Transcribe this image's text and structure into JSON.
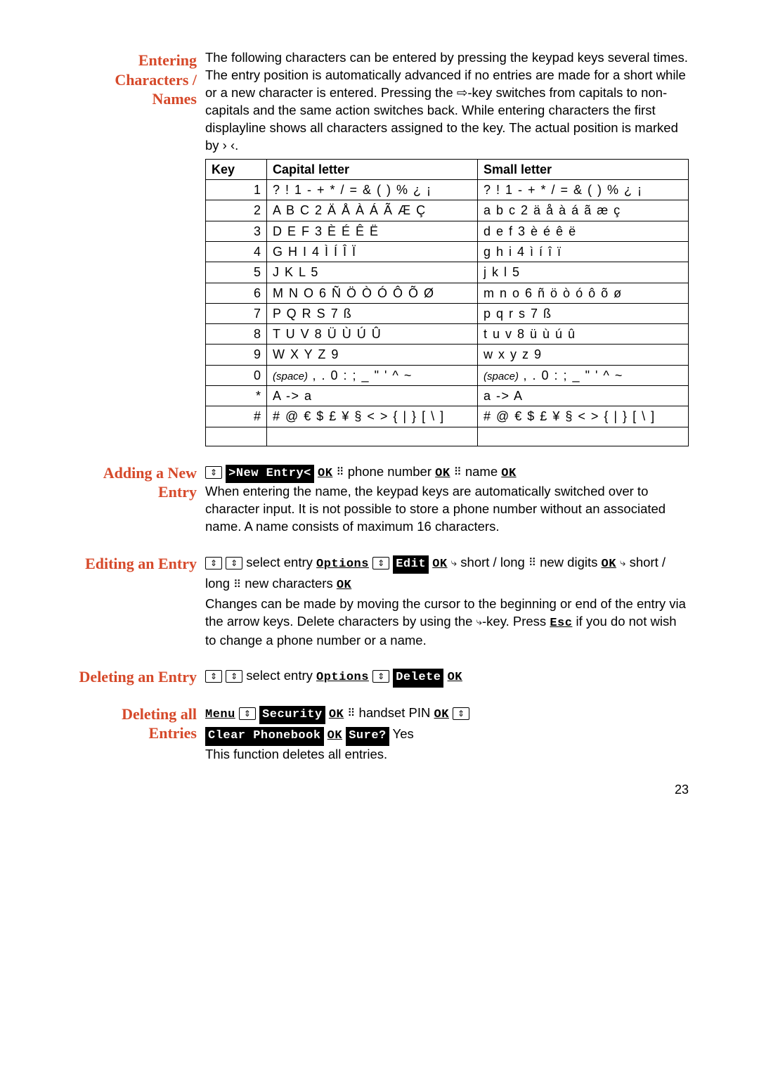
{
  "sections": {
    "entering": {
      "title": "Entering Characters / Names",
      "para": "The following characters can be entered by pressing the keypad keys several times. The entry position is automatically advanced if no entries are made for a short while or a new character is entered. Pressing the ⇨-key switches from capitals to non-capitals and the same action switches back. While entering characters the first displayline shows all characters assigned to the key. The actual position is marked by › ‹."
    },
    "adding": {
      "title": "Adding a New Entry",
      "para": "When entering the name, the keypad keys are automatically switched over to character input. It is not possible to store a phone number without an associated name. A name consists of maximum 16 characters."
    },
    "editing": {
      "title": "Editing an Entry",
      "para": "Changes can be made by moving the cursor to the beginning or end of the entry via the arrow keys. Delete characters by using the ⇨-key. Press Esc if you do not wish to change a phone number or a name."
    },
    "deleting": {
      "title": "Deleting an Entry"
    },
    "deletingAll": {
      "title": "Deleting all Entries",
      "para": "This function deletes all entries."
    }
  },
  "table": {
    "headers": [
      "Key",
      "Capital letter",
      "Small letter"
    ],
    "rows": [
      {
        "key": "1",
        "cap": "? ! 1 - + * / = & ( ) % ¿ ¡",
        "small": "? ! 1 - + * / = & ( ) % ¿ ¡"
      },
      {
        "key": "2",
        "cap": "A B C 2 Ä Å À Á Ã Æ Ç",
        "small": "a b c 2 ä å à á ã æ ç"
      },
      {
        "key": "3",
        "cap": "D E F 3 È É Ê Ë",
        "small": "d e f 3 è é ê ë"
      },
      {
        "key": "4",
        "cap": "G H I 4 Ì Í Î Ï",
        "small": "g h i 4 ì í î ï"
      },
      {
        "key": "5",
        "cap": "J K L 5",
        "small": "j k l 5"
      },
      {
        "key": "6",
        "cap": "M N O 6 Ñ Ö Ò Ó Ô Õ Ø",
        "small": "m n o 6 ñ ö ò ó ô õ ø"
      },
      {
        "key": "7",
        "cap": "P Q R S 7 ß",
        "small": "p q r s 7 ß"
      },
      {
        "key": "8",
        "cap": "T U V 8 Ü Ù Ú Û",
        "small": "t u v 8 ü ù ú û"
      },
      {
        "key": "9",
        "cap": "W X Y Z 9",
        "small": "w x y z 9"
      },
      {
        "key": "0",
        "cap_prefix": "(space)",
        "cap": " , . 0 : ; _ \" ' ^ ~",
        "small_prefix": "(space)",
        "small": " , . 0 : ; _ \" ' ^ ~"
      },
      {
        "key": "*",
        "cap": "A  ->  a",
        "small": "a  ->  A"
      },
      {
        "key": "#",
        "cap": "# @ € $ £ ¥ § < > { | } [ \\ ]",
        "small": "# @ € $ £ ¥ § < > { | } [ \\ ]"
      }
    ]
  },
  "steps": {
    "adding": {
      "newEntry": ">New Entry<",
      "ok": "OK",
      "phoneNumber": "phone number",
      "name": "name"
    },
    "editing": {
      "selectEntry": "select entry",
      "options": "Options",
      "edit": "Edit",
      "ok": "OK",
      "shortLong": "short / long",
      "newDigits": "new digits",
      "newChars": "new characters"
    },
    "deleting": {
      "selectEntry": "select entry",
      "options": "Options",
      "delete": "Delete",
      "ok": "OK"
    },
    "deletingAll": {
      "menu": "Menu",
      "security": "Security",
      "ok": "OK",
      "handsetPin": "handset PIN",
      "clearPhonebook": "Clear Phonebook",
      "sure": "Sure?",
      "yes": "Yes"
    }
  },
  "icons": {
    "updown": "⇕",
    "numeric": "⠿",
    "right": "⤷"
  },
  "page": "23"
}
